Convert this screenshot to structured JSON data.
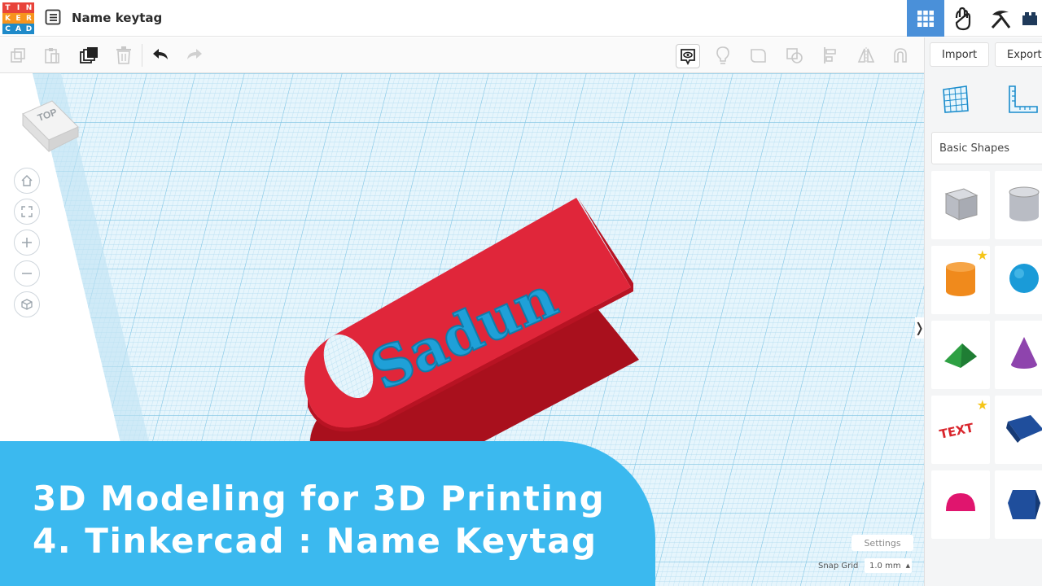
{
  "header": {
    "logo_letters": [
      "T",
      "I",
      "N",
      "K",
      "E",
      "R",
      "C",
      "A",
      "D"
    ],
    "logo_colors": [
      "#e8433a",
      "#e8433a",
      "#e8433a",
      "#f7941d",
      "#f7941d",
      "#f7941d",
      "#1f8ac9",
      "#1f8ac9",
      "#1f8ac9"
    ],
    "design_title": "Name keytag",
    "views": [
      "grid-view-icon",
      "tinker-hand-icon",
      "pickaxe-icon",
      "bricks-icon"
    ]
  },
  "toolbar": {
    "copy_icon": "copy-icon",
    "paste_icon": "paste-icon",
    "duplicate_icon": "duplicate-icon",
    "delete_icon": "delete-icon",
    "undo_icon": "undo-icon",
    "redo_icon": "redo-icon",
    "right_icons": [
      "notes-icon",
      "light-bulb-icon",
      "group-icon",
      "ungroup-icon",
      "align-icon",
      "mirror-icon",
      "magnet-icon"
    ]
  },
  "panel": {
    "import_label": "Import",
    "export_label": "Export",
    "category": "Basic Shapes",
    "shapes": [
      {
        "name": "box",
        "color": "#b9bcc4"
      },
      {
        "name": "cylinder-hole",
        "color": "#b9bcc4"
      },
      {
        "name": "cylinder",
        "color": "#f08a1c",
        "star": true
      },
      {
        "name": "sphere",
        "color": "#1a9bd8"
      },
      {
        "name": "roof",
        "color": "#2ea043"
      },
      {
        "name": "cone",
        "color": "#8e44ad"
      },
      {
        "name": "text",
        "color": "#d9252c",
        "star": true
      },
      {
        "name": "wedge",
        "color": "#1f4e9c"
      },
      {
        "name": "half-sphere",
        "color": "#e0156e"
      },
      {
        "name": "polygon",
        "color": "#1f4e9c"
      }
    ],
    "text_shape_label": "TEXT"
  },
  "workplane": {
    "view_cube_label": "TOP",
    "keytag_text": "Sadun",
    "keytag_color": "#e0263a",
    "text_color": "#1fa0d8",
    "nav_icons": [
      "home-icon",
      "fit-view-icon",
      "zoom-in-icon",
      "zoom-out-icon",
      "perspective-icon"
    ]
  },
  "banner": {
    "line1": "3D Modeling for 3D Printing",
    "line2": "4. Tinkercad : Name Keytag"
  },
  "footer": {
    "settings_label": "Settings",
    "snap_grid_label": "Snap Grid",
    "snap_grid_value": "1.0 mm"
  }
}
